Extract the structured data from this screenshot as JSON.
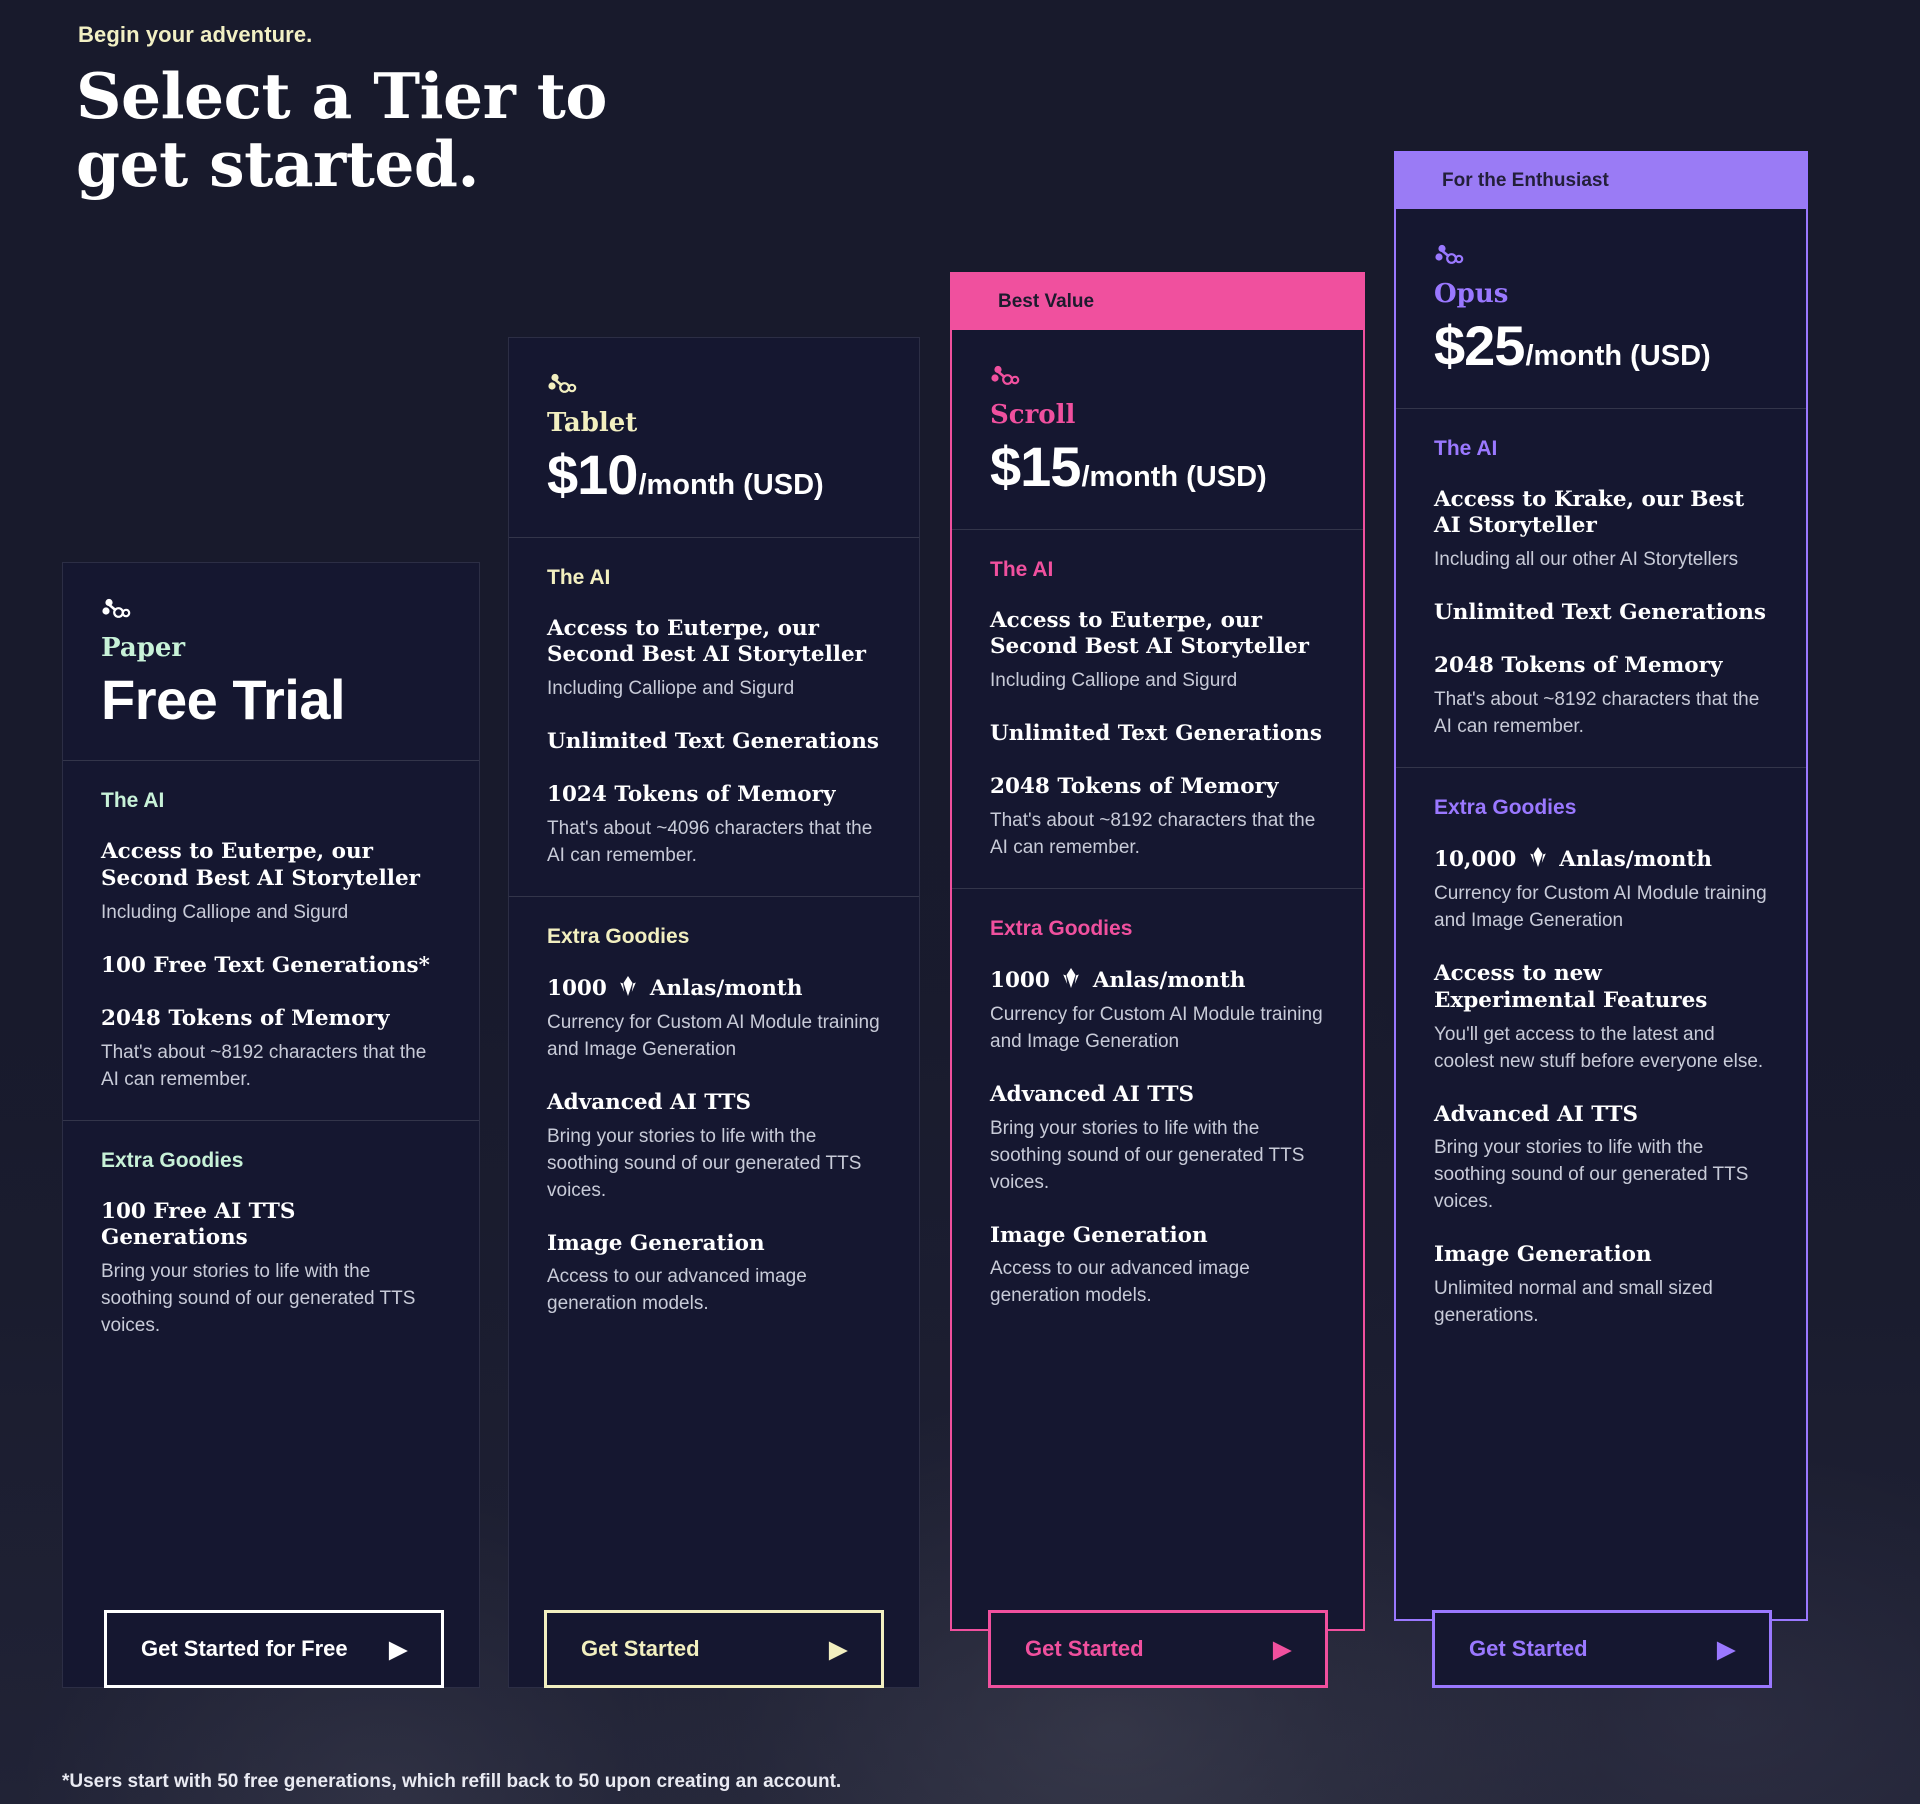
{
  "header": {
    "eyebrow": "Begin your adventure.",
    "headline_line1": "Select a Tier to",
    "headline_line2": "get started."
  },
  "colors": {
    "page_bg": "#1b1d30",
    "card_bg": "#151730",
    "paper_accent": "#c8f2d8",
    "tablet_accent": "#f2efc0",
    "scroll_accent": "#f0509e",
    "scroll_ribbon": "#f0509e",
    "opus_accent": "#9a78ff",
    "opus_ribbon": "#9a7bf5"
  },
  "footnote": "*Users start with 50 free generations, which refill back to 50 upon creating an account.",
  "tiers": [
    {
      "id": "paper",
      "ribbon": null,
      "icon": "molecule-icon",
      "name": "Paper",
      "price_amount": null,
      "price_period": null,
      "headline": "Free Trial",
      "cta": "Get Started for Free",
      "sections": [
        {
          "title": "The AI",
          "features": [
            {
              "title": "Access to Euterpe, our Second Best AI Storyteller",
              "sub": "Including Calliope and Sigurd"
            },
            {
              "title": "100 Free Text Generations*",
              "sub": null
            },
            {
              "title": "2048 Tokens of Memory",
              "sub": "That's about ~8192 characters that the AI can remember."
            }
          ]
        },
        {
          "title": "Extra Goodies",
          "features": [
            {
              "title": "100 Free AI TTS Generations",
              "sub": "Bring your stories to life with the soothing sound of our generated TTS voices."
            }
          ]
        }
      ]
    },
    {
      "id": "tablet",
      "ribbon": null,
      "icon": "molecule-icon",
      "name": "Tablet",
      "price_amount": "$10",
      "price_period": "/month (USD)",
      "headline": null,
      "cta": "Get Started",
      "sections": [
        {
          "title": "The AI",
          "features": [
            {
              "title": "Access to Euterpe, our Second Best AI Storyteller",
              "sub": "Including Calliope and Sigurd"
            },
            {
              "title": "Unlimited Text Generations",
              "sub": null
            },
            {
              "title": "1024 Tokens of Memory",
              "sub": "That's about ~4096 characters that the AI can remember."
            }
          ]
        },
        {
          "title": "Extra Goodies",
          "features": [
            {
              "title_pre": "1000",
              "anlas": true,
              "title_post": "Anlas/month",
              "title": null,
              "sub": "Currency for Custom AI Module training and Image Generation"
            },
            {
              "title": "Advanced AI TTS",
              "sub": "Bring your stories to life with the soothing sound of our generated TTS voices."
            },
            {
              "title": "Image Generation",
              "sub": "Access to our advanced image generation models."
            }
          ]
        }
      ]
    },
    {
      "id": "scroll",
      "ribbon": "Best Value",
      "icon": "molecule-icon",
      "name": "Scroll",
      "price_amount": "$15",
      "price_period": "/month (USD)",
      "headline": null,
      "cta": "Get Started",
      "sections": [
        {
          "title": "The AI",
          "features": [
            {
              "title": "Access to Euterpe, our Second Best AI Storyteller",
              "sub": "Including Calliope and Sigurd"
            },
            {
              "title": "Unlimited Text Generations",
              "sub": null
            },
            {
              "title": "2048 Tokens of Memory",
              "sub": "That's about ~8192 characters that the AI can remember."
            }
          ]
        },
        {
          "title": "Extra Goodies",
          "features": [
            {
              "title_pre": "1000",
              "anlas": true,
              "title_post": "Anlas/month",
              "title": null,
              "sub": "Currency for Custom AI Module training and Image Generation"
            },
            {
              "title": "Advanced AI TTS",
              "sub": "Bring your stories to life with the soothing sound of our generated TTS voices."
            },
            {
              "title": "Image Generation",
              "sub": "Access to our advanced image generation models."
            }
          ]
        }
      ]
    },
    {
      "id": "opus",
      "ribbon": "For the Enthusiast",
      "icon": "molecule-icon",
      "name": "Opus",
      "price_amount": "$25",
      "price_period": "/month (USD)",
      "headline": null,
      "cta": "Get Started",
      "sections": [
        {
          "title": "The AI",
          "features": [
            {
              "title": "Access to Krake, our Best AI Storyteller",
              "sub": "Including all our other AI Storytellers"
            },
            {
              "title": "Unlimited Text Generations",
              "sub": null
            },
            {
              "title": "2048 Tokens of Memory",
              "sub": "That's about ~8192 characters that the AI can remember."
            }
          ]
        },
        {
          "title": "Extra Goodies",
          "features": [
            {
              "title_pre": "10,000",
              "anlas": true,
              "title_post": "Anlas/month",
              "title": null,
              "sub": "Currency for Custom AI Module training and Image Generation"
            },
            {
              "title": "Access to new Experimental Features",
              "sub": "You'll get access to the latest and coolest new stuff before everyone else."
            },
            {
              "title": "Advanced AI TTS",
              "sub": "Bring your stories to life with the soothing sound of our generated TTS voices."
            },
            {
              "title": "Image Generation",
              "sub": "Unlimited normal and small sized generations."
            }
          ]
        }
      ]
    }
  ]
}
